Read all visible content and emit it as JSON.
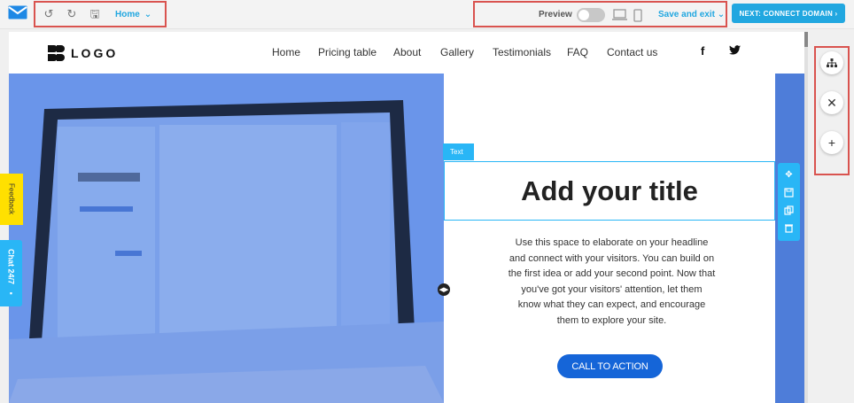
{
  "toolbar": {
    "brand_icon": "envelope-icon",
    "undo_icon": "undo-icon",
    "redo_icon": "redo-icon",
    "save_icon": "floppy-icon",
    "page": "Home",
    "preview_label": "Preview",
    "save_exit_label": "Save and exit",
    "next_label": "NEXT: CONNECT DOMAIN"
  },
  "site": {
    "logo_text": "LOGO",
    "nav": [
      "Home",
      "Pricing table",
      "About",
      "Gallery",
      "Testimonials",
      "FAQ",
      "Contact us"
    ],
    "social": [
      "f",
      "twitter"
    ],
    "text_tag": "Text",
    "title": "Add your title",
    "body_lines": [
      "Use this space to elaborate on your headline",
      "and connect with your visitors. You can build on",
      "the first idea or add your second point. Now that",
      "you've got your visitors' attention, let them",
      "know what they can expect, and encourage",
      "them to explore your site."
    ],
    "cta_label": "CALL TO ACTION"
  },
  "side_actions": [
    "sitemap-icon",
    "close-icon",
    "plus-icon"
  ],
  "tabs": {
    "feedback": "Feedback",
    "chat": "Chat 24/7"
  },
  "colors": {
    "accent": "#21a7e0",
    "cta": "#1565d8",
    "hero_overlay": "#5f8de7",
    "highlight_box": "#d9534f"
  }
}
